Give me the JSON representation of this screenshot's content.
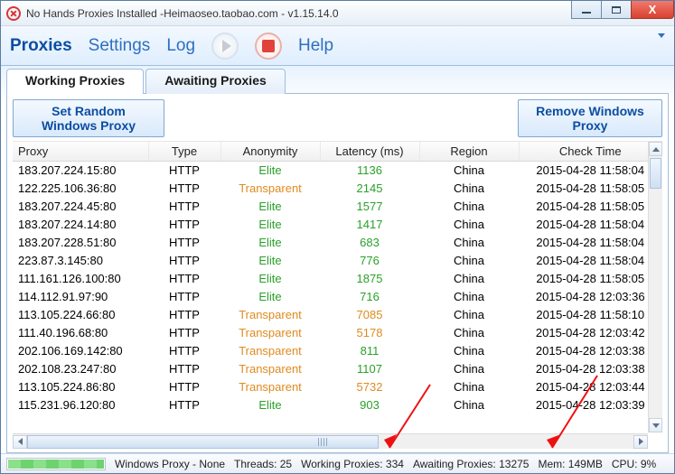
{
  "window": {
    "title": "No Hands Proxies Installed -Heimaoseo.taobao.com - v1.15.14.0"
  },
  "toolbar": {
    "proxies": "Proxies",
    "settings": "Settings",
    "log": "Log",
    "help": "Help"
  },
  "tabs": {
    "working": "Working Proxies",
    "awaiting": "Awaiting Proxies"
  },
  "buttons": {
    "set_random": "Set Random Windows Proxy",
    "remove": "Remove Windows Proxy"
  },
  "columns": {
    "proxy": "Proxy",
    "type": "Type",
    "anon": "Anonymity",
    "latency": "Latency (ms)",
    "region": "Region",
    "check": "Check Time"
  },
  "rows": [
    {
      "proxy": "183.207.224.15:80",
      "type": "HTTP",
      "anon": "Elite",
      "anonCls": "elite",
      "lat": "1136",
      "latCls": "",
      "region": "China",
      "check": "2015-04-28 11:58:04"
    },
    {
      "proxy": "122.225.106.36:80",
      "type": "HTTP",
      "anon": "Transparent",
      "anonCls": "trans",
      "lat": "2145",
      "latCls": "",
      "region": "China",
      "check": "2015-04-28 11:58:05"
    },
    {
      "proxy": "183.207.224.45:80",
      "type": "HTTP",
      "anon": "Elite",
      "anonCls": "elite",
      "lat": "1577",
      "latCls": "",
      "region": "China",
      "check": "2015-04-28 11:58:05"
    },
    {
      "proxy": "183.207.224.14:80",
      "type": "HTTP",
      "anon": "Elite",
      "anonCls": "elite",
      "lat": "1417",
      "latCls": "",
      "region": "China",
      "check": "2015-04-28 11:58:04"
    },
    {
      "proxy": "183.207.228.51:80",
      "type": "HTTP",
      "anon": "Elite",
      "anonCls": "elite",
      "lat": "683",
      "latCls": "",
      "region": "China",
      "check": "2015-04-28 11:58:04"
    },
    {
      "proxy": "223.87.3.145:80",
      "type": "HTTP",
      "anon": "Elite",
      "anonCls": "elite",
      "lat": "776",
      "latCls": "",
      "region": "China",
      "check": "2015-04-28 11:58:04"
    },
    {
      "proxy": "111.161.126.100:80",
      "type": "HTTP",
      "anon": "Elite",
      "anonCls": "elite",
      "lat": "1875",
      "latCls": "",
      "region": "China",
      "check": "2015-04-28 11:58:05"
    },
    {
      "proxy": "114.112.91.97:90",
      "type": "HTTP",
      "anon": "Elite",
      "anonCls": "elite",
      "lat": "716",
      "latCls": "",
      "region": "China",
      "check": "2015-04-28 12:03:36"
    },
    {
      "proxy": "113.105.224.66:80",
      "type": "HTTP",
      "anon": "Transparent",
      "anonCls": "trans",
      "lat": "7085",
      "latCls": "warn",
      "region": "China",
      "check": "2015-04-28 11:58:10"
    },
    {
      "proxy": "111.40.196.68:80",
      "type": "HTTP",
      "anon": "Transparent",
      "anonCls": "trans",
      "lat": "5178",
      "latCls": "warn",
      "region": "China",
      "check": "2015-04-28 12:03:42"
    },
    {
      "proxy": "202.106.169.142:80",
      "type": "HTTP",
      "anon": "Transparent",
      "anonCls": "trans",
      "lat": "811",
      "latCls": "",
      "region": "China",
      "check": "2015-04-28 12:03:38"
    },
    {
      "proxy": "202.108.23.247:80",
      "type": "HTTP",
      "anon": "Transparent",
      "anonCls": "trans",
      "lat": "1107",
      "latCls": "",
      "region": "China",
      "check": "2015-04-28 12:03:38"
    },
    {
      "proxy": "113.105.224.86:80",
      "type": "HTTP",
      "anon": "Transparent",
      "anonCls": "trans",
      "lat": "5732",
      "latCls": "warn",
      "region": "China",
      "check": "2015-04-28 12:03:44"
    },
    {
      "proxy": "115.231.96.120:80",
      "type": "HTTP",
      "anon": "Elite",
      "anonCls": "elite",
      "lat": "903",
      "latCls": "",
      "region": "China",
      "check": "2015-04-28 12:03:39"
    }
  ],
  "status": {
    "winproxy": "Windows Proxy - None",
    "threads": "Threads: 25",
    "working": "Working Proxies: 334",
    "awaiting": "Awaiting Proxies: 13275",
    "mem": "Mem: 149MB",
    "cpu": "CPU: 9%"
  }
}
